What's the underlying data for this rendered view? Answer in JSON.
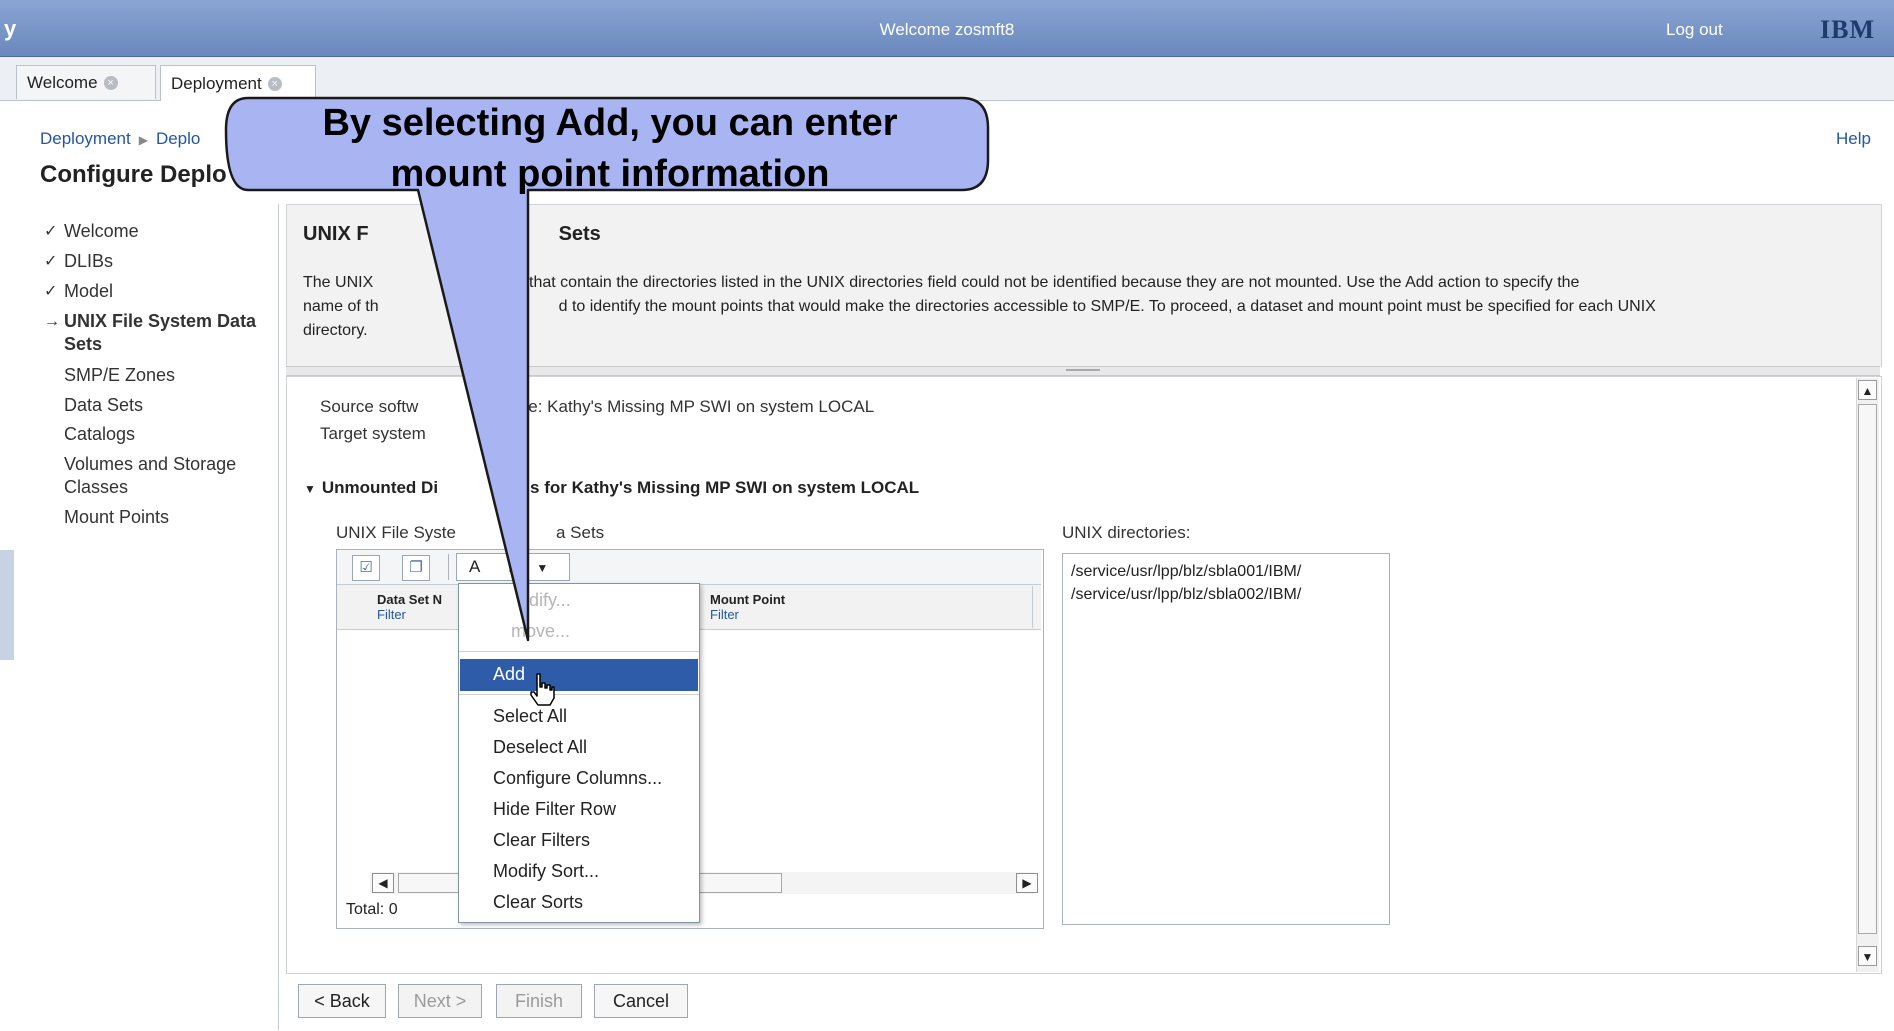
{
  "banner": {
    "left_fragment": "y",
    "welcome": "Welcome zosmft8",
    "logout": "Log out",
    "logo": "IBM"
  },
  "tabs": [
    {
      "label": "Welcome"
    },
    {
      "label": "Deployment"
    }
  ],
  "breadcrumb": {
    "item1": "Deployment",
    "item2": "Deplo"
  },
  "page_title": "Configure Deplo",
  "help": "Help",
  "nav": {
    "items": [
      {
        "label": "Welcome",
        "mark": "✓"
      },
      {
        "label": "DLIBs",
        "mark": "✓"
      },
      {
        "label": "Model",
        "mark": "✓"
      },
      {
        "label_line1": "UNIX File System Data",
        "label_line2": "Sets",
        "mark": "→"
      },
      {
        "label": "SMP/E Zones"
      },
      {
        "label": "Data Sets"
      },
      {
        "label": "Catalogs"
      },
      {
        "label_line1": "Volumes and Storage",
        "label_line2": "Classes"
      },
      {
        "label": "Mount Points"
      }
    ]
  },
  "header": {
    "title_a": "UNIX F",
    "title_b": "Sets",
    "desc_line1_a": "The UNIX",
    "desc_line1_b": "ets that contain the directories listed in the UNIX directories field could not be identified because they are not mounted. Use the Add action to specify the",
    "desc_line2_a": "name of th",
    "desc_line2_b": "d to identify the mount points that would make the directories accessible to SMP/E.  To proceed, a dataset and mount point must be specified for each UNIX",
    "desc_line3": "directory."
  },
  "main": {
    "source_a": "Source softw",
    "source_b": "e: Kathy's Missing MP SWI on system LOCAL",
    "target_a": "Target system",
    "section_a": "Unmounted Di",
    "section_b": "s for Kathy's Missing MP SWI on system LOCAL",
    "table_label_a": "UNIX File Syste",
    "table_label_b": "a Sets",
    "actions_a": "A",
    "actions_b": "ns",
    "col1": "Data Set N",
    "col1_filter": "Filter",
    "col2": "Mount Point",
    "col2_filter": "Filter",
    "total": "Total: 0",
    "dirs_label": "UNIX directories:",
    "dirs": [
      "/service/usr/lpp/blz/sbla001/IBM/",
      "/service/usr/lpp/blz/sbla002/IBM/"
    ]
  },
  "menu": {
    "modify": "odify...",
    "remove": "move...",
    "add": "Add",
    "select_all": "Select All",
    "deselect_all": "Deselect All",
    "configure_columns": "Configure Columns...",
    "hide_filter_row": "Hide Filter Row",
    "clear_filters": "Clear Filters",
    "modify_sort": "Modify Sort...",
    "clear_sorts": "Clear Sorts"
  },
  "buttons": {
    "back": "< Back",
    "next": "Next >",
    "finish": "Finish",
    "cancel": "Cancel"
  },
  "callout": {
    "line1": "By selecting Add, you can enter",
    "line2": "mount point information",
    "fill": "#a9b4f2"
  },
  "colors": {
    "banner": "#7892c6",
    "selected_menu": "#2f5ca9",
    "link": "#2456a4"
  }
}
